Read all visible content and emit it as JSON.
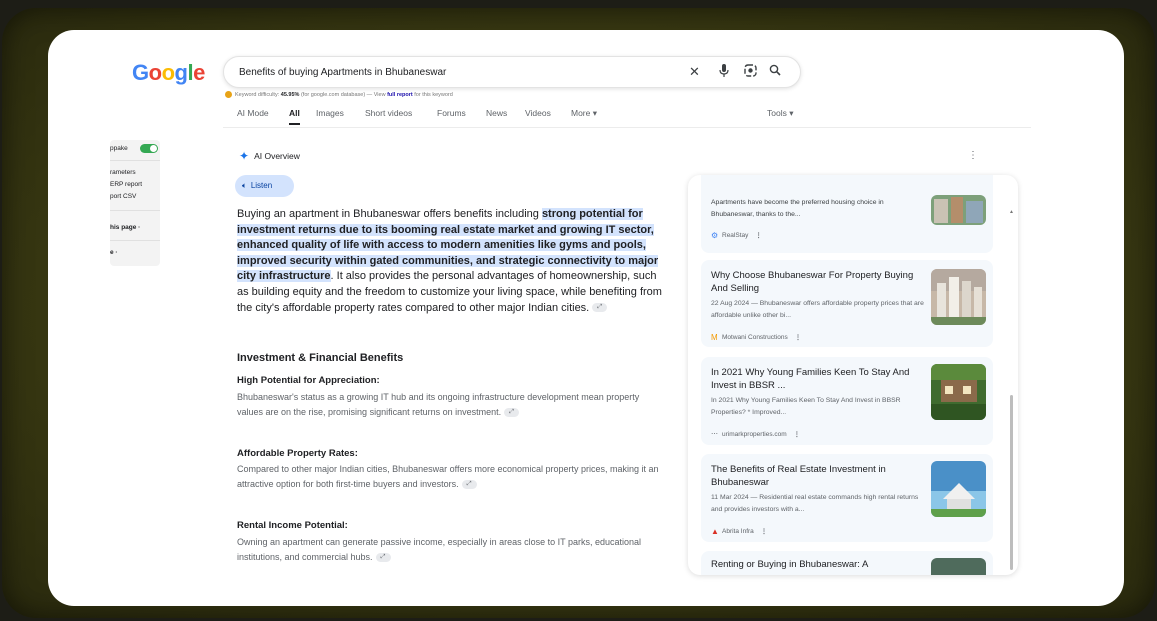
{
  "search": {
    "logo": "Google",
    "query": "Benefits of buying Apartments in Bhubaneswar",
    "keyword_line": {
      "prefix": "Keyword difficulty:",
      "value": "45.95%",
      "middle": "(for google.com database) — View",
      "link": "full report",
      "suffix": "for this keyword"
    },
    "tabs": [
      {
        "label": "AI Mode",
        "active": false
      },
      {
        "label": "All",
        "active": true
      },
      {
        "label": "Images",
        "active": false
      },
      {
        "label": "Short videos",
        "active": false
      },
      {
        "label": "Forums",
        "active": false
      },
      {
        "label": "News",
        "active": false
      },
      {
        "label": "Videos",
        "active": false
      },
      {
        "label": "More ▾",
        "active": false
      }
    ],
    "tools": "Tools ▾"
  },
  "side_panel": {
    "lines": [
      "ppake",
      "rameters",
      "ERP report",
      "port CSV",
      "his page ·",
      "e ·"
    ]
  },
  "ai_overview": {
    "heading": "AI Overview",
    "listen": "Listen",
    "intro_plain_1": "Buying an apartment in Bhubaneswar offers benefits including ",
    "intro_highlight": "strong potential for investment returns due to its booming real estate market and growing IT sector, enhanced quality of life with access to modern amenities like gyms and pools, improved security within gated communities, and strategic connectivity to major city infrastructure",
    "intro_plain_2": ". It also provides the personal advantages of homeownership, such as building equity and the freedom to customize your living space, while benefiting from the city's affordable property rates compared to other major Indian cities.",
    "section_title": "Investment & Financial Benefits",
    "items": [
      {
        "title": "High Potential for Appreciation:",
        "text": "Bhubaneswar's status as a growing IT hub and its ongoing infrastructure development mean property values are on the rise, promising significant returns on investment."
      },
      {
        "title": "Affordable Property Rates:",
        "text": "Compared to other major Indian cities, Bhubaneswar offers more economical property prices, making it an attractive option for both first-time buyers and investors."
      },
      {
        "title": "Rental Income Potential:",
        "text": "Owning an apartment can generate passive income, especially in areas close to IT parks, educational institutions, and commercial hubs."
      }
    ]
  },
  "results_panel": {
    "close": "✕",
    "cards": [
      {
        "title": "",
        "snippet": "Apartments have become the preferred housing choice in Bhubaneswar, thanks to the...",
        "source": "RealStay",
        "icon_color": "#4285f4"
      },
      {
        "title": "Why Choose Bhubaneswar For Property Buying And Selling",
        "snippet": "22 Aug 2024 — Bhubaneswar offers affordable property prices that are affordable unlike other bi...",
        "source": "Motwani Constructions",
        "icon_color": "#f29900"
      },
      {
        "title": "In 2021 Why Young Families Keen To Stay And Invest in BBSR ...",
        "snippet": "In 2021 Why Young Families Keen To Stay And Invest in BBSR Properties? * Improved...",
        "source": "urimarkproperties.com",
        "icon_color": "#5f6368"
      },
      {
        "title": "The Benefits of Real Estate Investment in Bhubaneswar",
        "snippet": "11 Mar 2024 — Residential real estate commands high rental returns and provides investors with a...",
        "source": "Abrita Infra",
        "icon_color": "#d93025"
      },
      {
        "title": "Renting or Buying in Bhubaneswar: A",
        "snippet": "",
        "source": "",
        "icon_color": "#5f6368"
      }
    ]
  },
  "colors": {
    "accent": "#1a73e8",
    "highlight": "#d3e3fd",
    "frame": "#3a3a12"
  }
}
